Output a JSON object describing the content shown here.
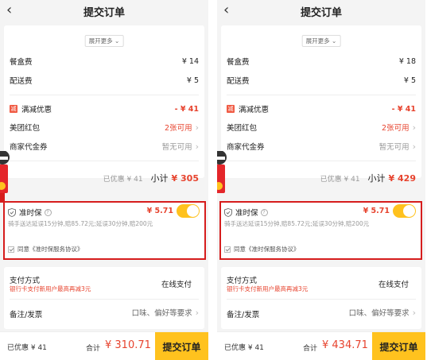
{
  "screens": [
    {
      "header": {
        "back_icon": "chevron-left-icon",
        "title": "提交订单"
      },
      "expand_label": "展开更多",
      "package_fee": {
        "label": "餐盒费",
        "value": "¥ 14"
      },
      "delivery_fee": {
        "label": "配送费",
        "value": "¥ 5"
      },
      "full_discount": {
        "badge": "减",
        "label": "满减优惠",
        "value": "- ¥ 41"
      },
      "red_packet": {
        "label": "美团红包",
        "value": "2张可用"
      },
      "voucher": {
        "label": "商家代金券",
        "value": "暂无可用"
      },
      "subtotal": {
        "saved": "已优惠 ¥ 41",
        "label": "小计",
        "value": "¥ 305"
      },
      "insurance": {
        "label": "准时保",
        "price": "¥ 5.71",
        "toggle_on": true,
        "desc": "骑手送达延误15分钟,赔85.72元;延误30分钟,赔200元",
        "agree": "同意《准时保服务协议》"
      },
      "payment": {
        "label": "支付方式",
        "promo": "银行卡支付新用户最高再减3元",
        "value": "在线支付"
      },
      "note": {
        "label": "备注/发票",
        "value": "口味、偏好等要求"
      },
      "footer": {
        "saved": "已优惠 ¥ 41",
        "total_label": "合计",
        "total": "¥ 310.71",
        "submit": "提交订单"
      }
    },
    {
      "header": {
        "back_icon": "chevron-left-icon",
        "title": "提交订单"
      },
      "expand_label": "展开更多",
      "package_fee": {
        "label": "餐盒费",
        "value": "¥ 18"
      },
      "delivery_fee": {
        "label": "配送费",
        "value": "¥ 5"
      },
      "full_discount": {
        "badge": "减",
        "label": "满减优惠",
        "value": "- ¥ 41"
      },
      "red_packet": {
        "label": "美团红包",
        "value": "2张可用"
      },
      "voucher": {
        "label": "商家代金券",
        "value": "暂无可用"
      },
      "subtotal": {
        "saved": "已优惠 ¥ 41",
        "label": "小计",
        "value": "¥ 429"
      },
      "insurance": {
        "label": "准时保",
        "price": "¥ 5.71",
        "toggle_on": true,
        "desc": "骑手送达延误15分钟,赔85.72元;延误30分钟,赔200元",
        "agree": "同意《准时保服务协议》"
      },
      "payment": {
        "label": "支付方式",
        "promo": "银行卡支付新用户最高再减3元",
        "value": "在线支付"
      },
      "note": {
        "label": "备注/发票",
        "value": "口味、偏好等要求"
      },
      "footer": {
        "saved": "已优惠 ¥ 41",
        "total_label": "合计",
        "total": "¥ 434.71",
        "submit": "提交订单"
      }
    }
  ],
  "colors": {
    "accent": "#ffc21e",
    "price_red": "#e7432e",
    "highlight_border": "#d61d1d"
  }
}
